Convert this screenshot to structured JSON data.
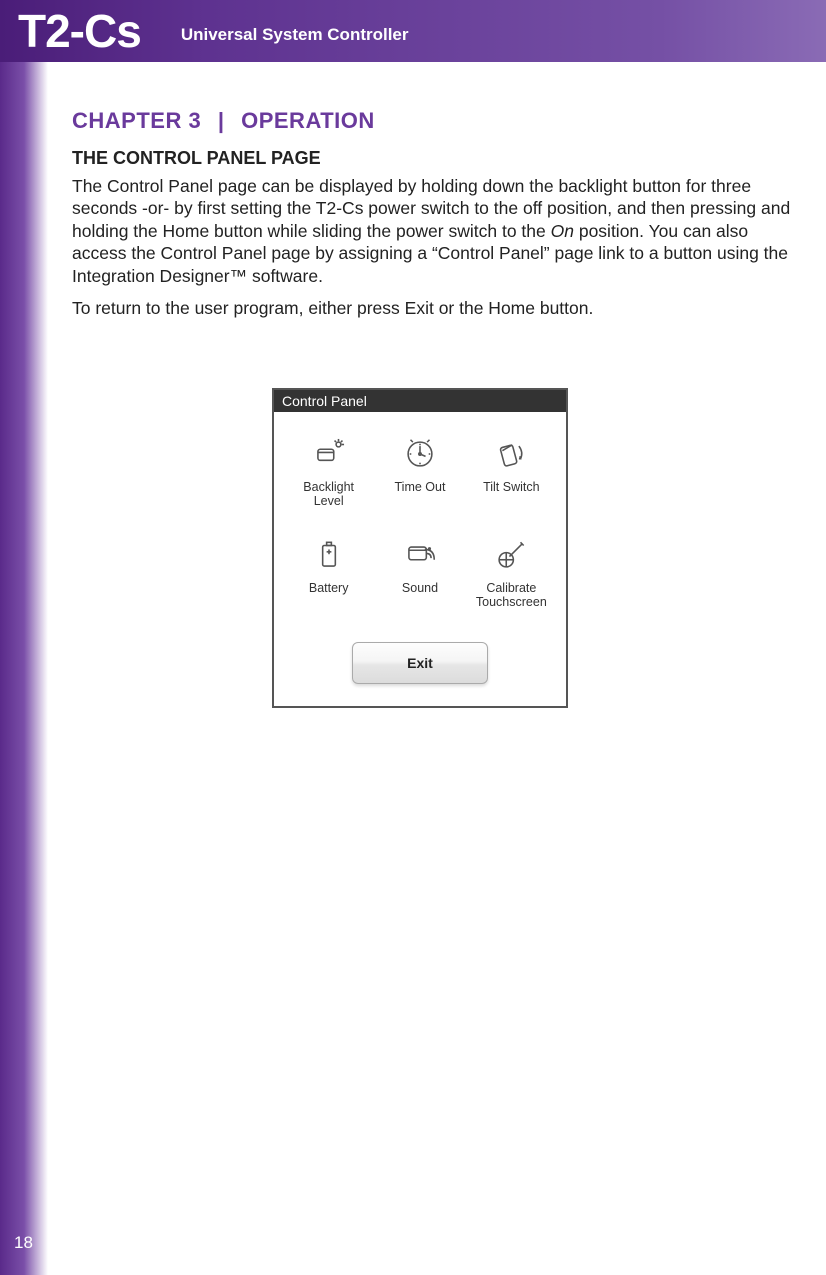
{
  "header": {
    "product": "T2-Cs",
    "subtitle": "Universal System Controller"
  },
  "chapter": {
    "prefix": "CHAPTER 3",
    "separator": "|",
    "title": "OPERATION"
  },
  "section_heading": "THE CONTROL PANEL PAGE",
  "para1_a": "The Control Panel page can be displayed by holding down the backlight button for three seconds -or- by first setting the T2-Cs power switch to the off position, and then pressing and holding the Home button while sliding the power switch to the ",
  "para1_em": "On",
  "para1_b": " position. You can also access the Control Panel page by assigning a “Control Panel” page link to a button using the Integration Designer™ software.",
  "para2": "To return to the user program, either press Exit or the Home button.",
  "device": {
    "title": "Control Panel",
    "items": [
      {
        "label": "Backlight Level"
      },
      {
        "label": "Time Out"
      },
      {
        "label": "Tilt Switch"
      },
      {
        "label": "Battery"
      },
      {
        "label": "Sound"
      },
      {
        "label": "Calibrate Touchscreen"
      }
    ],
    "exit_label": "Exit"
  },
  "page_number": "18"
}
